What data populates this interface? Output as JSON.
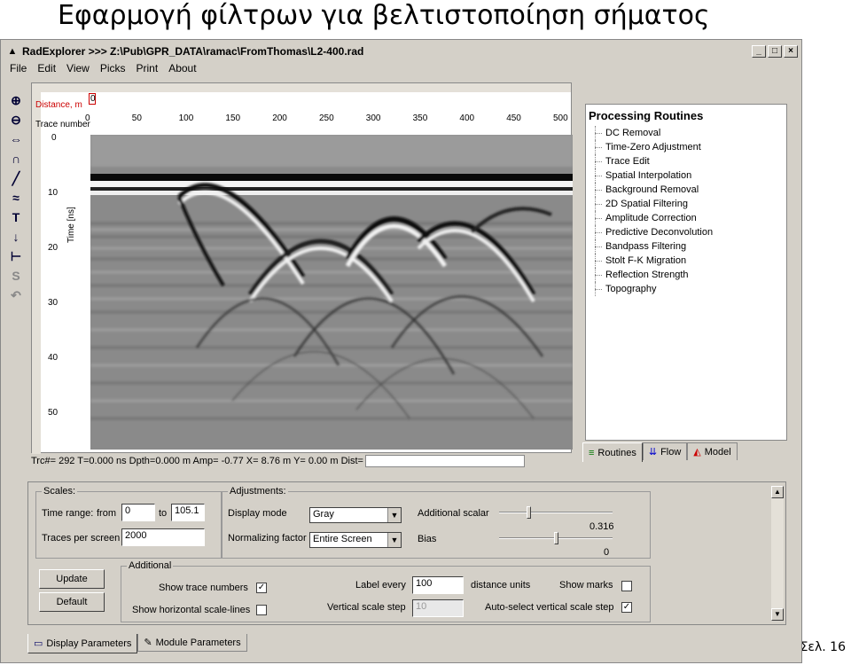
{
  "slide": {
    "title": "Εφαρμογή φίλτρων για βελτιστοποίηση σήματος",
    "page": "Σελ. 16"
  },
  "window": {
    "title": "RadExplorer >>> Z:\\Pub\\GPR_DATA\\ramac\\FromThomas\\L2-400.rad",
    "min": "_",
    "max": "□",
    "close": "×"
  },
  "menu": [
    "File",
    "Edit",
    "View",
    "Picks",
    "Print",
    "About"
  ],
  "toolbar_icons": [
    "zoom-in-icon",
    "zoom-out-icon",
    "ruler-icon",
    "hyperbola-icon",
    "line-icon",
    "wiggle-icon",
    "text-icon",
    "pick-icon",
    "tm-icon",
    "s-icon",
    "undo-icon"
  ],
  "plot": {
    "distance_label": "Distance, m",
    "distance_value": "0",
    "trace_label": "Trace number",
    "time_label": "Time [ns]",
    "x_ticks": [
      "0",
      "50",
      "100",
      "150",
      "200",
      "250",
      "300",
      "350",
      "400",
      "450",
      "500"
    ],
    "y_ticks": [
      "0",
      "10",
      "20",
      "30",
      "40",
      "50"
    ]
  },
  "status": {
    "text": "Trc#= 292  T=0.000 ns  Dpth=0.000 m  Amp= -0.77  X=  8.76 m  Y=  0.00 m  Dist="
  },
  "processing": {
    "title": "Processing Routines",
    "items": [
      "DC Removal",
      "Time-Zero Adjustment",
      "Trace Edit",
      "Spatial Interpolation",
      "Background Removal",
      "2D Spatial Filtering",
      "Amplitude Correction",
      "Predictive Deconvolution",
      "Bandpass Filtering",
      "Stolt F-K Migration",
      "Reflection Strength",
      "Topography"
    ],
    "tabs": [
      "Routines",
      "Flow",
      "Model"
    ]
  },
  "scales": {
    "title": "Scales:",
    "time_range_label": "Time range:",
    "from_label": "from",
    "from_value": "0",
    "to_label": "to",
    "to_value": "105.1",
    "traces_label": "Traces per screen",
    "traces_value": "2000"
  },
  "adjustments": {
    "title": "Adjustments:",
    "display_mode_label": "Display mode",
    "display_mode_value": "Gray",
    "normalizing_label": "Normalizing factor",
    "normalizing_value": "Entire Screen",
    "scalar_label": "Additional scalar",
    "scalar_value": "0.316",
    "scalar_level": 0.25,
    "bias_label": "Bias",
    "bias_value": "0",
    "bias_level": 0.5
  },
  "buttons": {
    "update": "Update",
    "default": "Default"
  },
  "additional": {
    "title": "Additional",
    "show_trace_numbers": "Show trace numbers",
    "show_trace_numbers_checked": true,
    "show_hscale": "Show horizontal scale-lines",
    "show_hscale_checked": false,
    "label_every": "Label every",
    "label_every_value": "100",
    "distance_units": "distance units",
    "show_marks": "Show marks",
    "show_marks_checked": false,
    "vertical_step": "Vertical scale step",
    "vertical_step_value": "10",
    "auto_select": "Auto-select vertical scale step",
    "auto_select_checked": true
  },
  "bottom_tabs": [
    "Display Parameters",
    "Module Parameters"
  ]
}
